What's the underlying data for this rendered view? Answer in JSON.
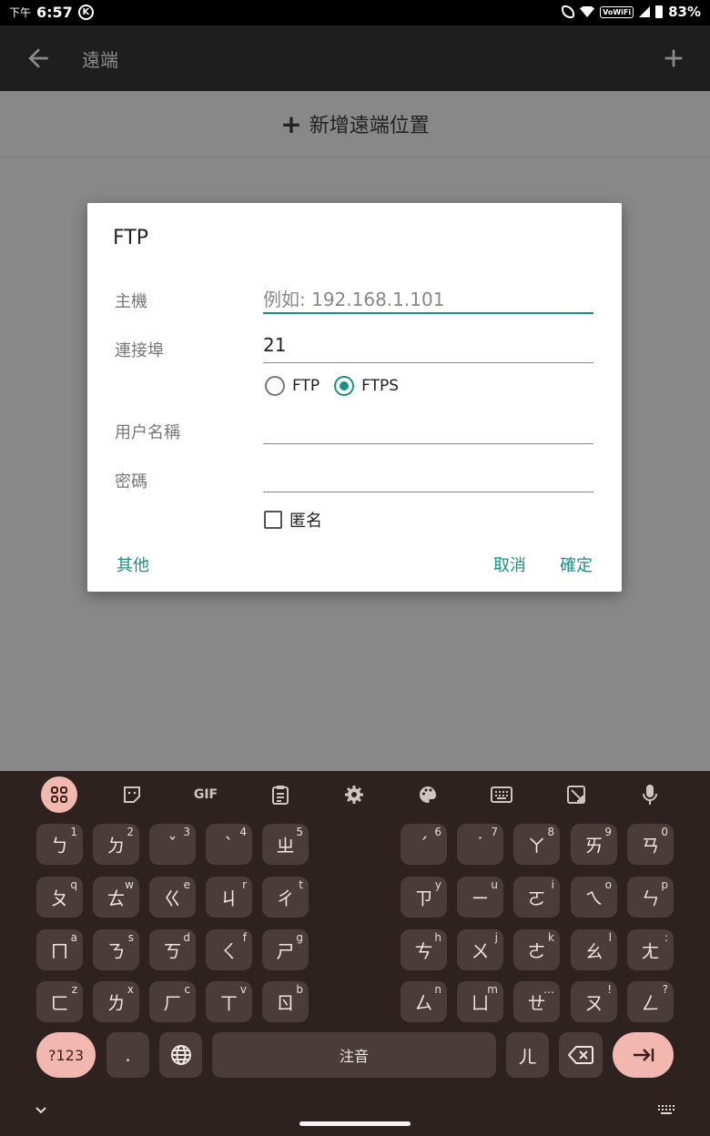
{
  "status_bar": {
    "ampm": "下午",
    "time": "6:57",
    "k_badge": "K",
    "vowifi": "VoWiFi",
    "battery": "83%"
  },
  "app_bar": {
    "title": "遠端",
    "back_icon": "arrow-left-icon",
    "add_icon": "plus-icon"
  },
  "list": {
    "add_label": "新增遠端位置"
  },
  "dialog": {
    "title": "FTP",
    "host_label": "主機",
    "host_placeholder": "例如: 192.168.1.101",
    "port_label": "連接埠",
    "port_value": "21",
    "protocol_options": [
      "FTP",
      "FTPS"
    ],
    "protocol_selected": "FTPS",
    "username_label": "用户名稱",
    "username_value": "",
    "password_label": "密碼",
    "password_value": "",
    "anonymous_label": "匿名",
    "anonymous_checked": false,
    "other_button": "其他",
    "cancel_button": "取消",
    "ok_button": "確定",
    "accent_color": "#1b8f84"
  },
  "keyboard": {
    "toolbar": {
      "gif": "GIF"
    },
    "rows": [
      [
        [
          "ㄅ",
          "1"
        ],
        [
          "ㄉ",
          "2"
        ],
        [
          "ˇ",
          "3"
        ],
        [
          "ˋ",
          "4"
        ],
        [
          "ㄓ",
          "5"
        ],
        [
          "ˊ",
          "6"
        ],
        [
          "˙",
          "7"
        ],
        [
          "ㄚ",
          "8"
        ],
        [
          "ㄞ",
          "9"
        ],
        [
          "ㄢ",
          "0"
        ]
      ],
      [
        [
          "ㄆ",
          "q"
        ],
        [
          "ㄊ",
          "w"
        ],
        [
          "ㄍ",
          "e"
        ],
        [
          "ㄐ",
          "r"
        ],
        [
          "ㄔ",
          "t"
        ],
        [
          "ㄗ",
          "y"
        ],
        [
          "ㄧ",
          "u"
        ],
        [
          "ㄛ",
          "i"
        ],
        [
          "ㄟ",
          "o"
        ],
        [
          "ㄣ",
          "p"
        ]
      ],
      [
        [
          "ㄇ",
          "a"
        ],
        [
          "ㄋ",
          "s"
        ],
        [
          "ㄎ",
          "d"
        ],
        [
          "ㄑ",
          "f"
        ],
        [
          "ㄕ",
          "g"
        ],
        [
          "ㄘ",
          "h"
        ],
        [
          "ㄨ",
          "j"
        ],
        [
          "ㄜ",
          "k"
        ],
        [
          "ㄠ",
          "l"
        ],
        [
          "ㄤ",
          ":"
        ]
      ],
      [
        [
          "ㄈ",
          "z"
        ],
        [
          "ㄌ",
          "x"
        ],
        [
          "ㄏ",
          "c"
        ],
        [
          "ㄒ",
          "v"
        ],
        [
          "ㄖ",
          "b"
        ],
        [
          "ㄙ",
          "n"
        ],
        [
          "ㄩ",
          "m"
        ],
        [
          "ㄝ",
          "…"
        ],
        [
          "ㄡ",
          "!"
        ],
        [
          "ㄥ",
          "?"
        ]
      ]
    ],
    "sym_key": "?123",
    "period_key": ".",
    "space_label": "注音",
    "er_key": "ㄦ",
    "accent_color": "#f2b8b0"
  }
}
